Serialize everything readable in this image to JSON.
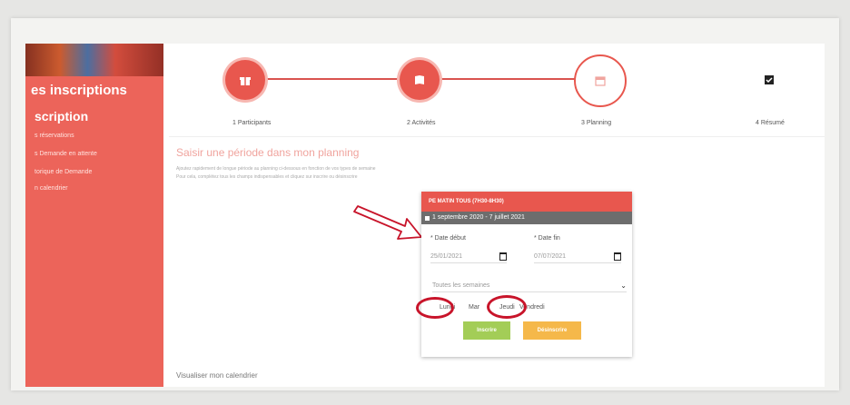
{
  "sidebar": {
    "title": "es inscriptions",
    "subtitle": "scription",
    "links": [
      "s réservations",
      "s Demande en attente",
      "torique de Demande",
      "n calendrier"
    ]
  },
  "stepper": {
    "steps": [
      {
        "label": "1 Participants",
        "icon": "gift-icon",
        "state": "done"
      },
      {
        "label": "2 Activités",
        "icon": "book-icon",
        "state": "done"
      },
      {
        "label": "3 Planning",
        "icon": "calendar-icon",
        "state": "active"
      },
      {
        "label": "4 Résumé",
        "icon": "check-calendar-icon",
        "state": "todo"
      }
    ]
  },
  "main": {
    "section_title": "Saisir une période dans mon planning",
    "help_line1": "Ajoutez rapidement de longue période au planning ci-dessous en fonction de vos types de semaine",
    "help_line2": "Pour cela, complétez tous les champs indispensables et cliquez sur inscrire ou désinscrire",
    "bottom_link": "Visualiser mon calendrier"
  },
  "card": {
    "header": "PE MATIN TOUS (7H30-8H30)",
    "period": "1 septembre 2020 - 7 juillet 2021",
    "start_label": "* Date début",
    "end_label": "* Date fin",
    "start_value": "25/01/2021",
    "end_value": "07/07/2021",
    "weeks_select": "Toutes les semaines",
    "days": [
      "Lundi",
      "Mar",
      "Jeudi",
      "Vendredi"
    ],
    "enroll_button": "Inscrire",
    "unenroll_button": "Désinscrire"
  },
  "colors": {
    "brand": "#ec645a",
    "enroll": "#a3cd57",
    "unenroll": "#f5b84a",
    "highlight": "#c8142a"
  }
}
